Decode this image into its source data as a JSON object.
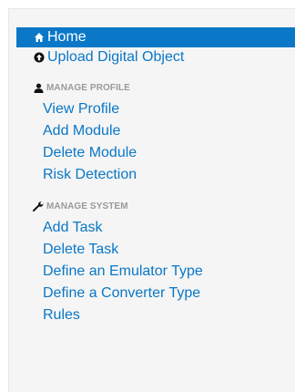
{
  "nav": {
    "home": {
      "label": "Home",
      "icon": "home-icon"
    },
    "upload": {
      "label": "Upload Digital Object",
      "icon": "upload-icon"
    }
  },
  "manage_profile": {
    "heading": "MANAGE PROFILE",
    "icon": "user-icon",
    "items": [
      {
        "label": "View Profile"
      },
      {
        "label": "Add Module"
      },
      {
        "label": "Delete Module"
      },
      {
        "label": "Risk Detection"
      }
    ]
  },
  "manage_system": {
    "heading": "MANAGE SYSTEM",
    "icon": "wrench-icon",
    "items": [
      {
        "label": "Add Task"
      },
      {
        "label": "Delete Task"
      },
      {
        "label": "Define an Emulator Type"
      },
      {
        "label": "Define a Converter Type"
      },
      {
        "label": "Rules"
      }
    ]
  },
  "colors": {
    "active_bg": "#0a78c7",
    "link": "#0a77c6",
    "header": "#9a9a9a",
    "panel_bg": "#f5f5f5"
  }
}
